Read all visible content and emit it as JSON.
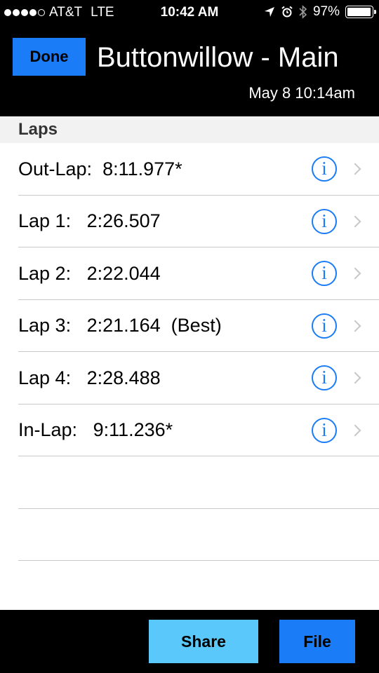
{
  "status_bar": {
    "carrier": "AT&T",
    "network": "LTE",
    "time": "10:42 AM",
    "battery_percent": "97%",
    "battery_level": 0.97,
    "signal_bars_filled": 4,
    "signal_bars_total": 5
  },
  "header": {
    "done_label": "Done",
    "title": "Buttonwillow - Main",
    "session_date": "May 8 10:14am"
  },
  "section": {
    "title": "Laps"
  },
  "laps": [
    {
      "label": "Out-Lap:  8:11.977*"
    },
    {
      "label": "Lap 1:   2:26.507"
    },
    {
      "label": "Lap 2:   2:22.044"
    },
    {
      "label": "Lap 3:   2:21.164  (Best)"
    },
    {
      "label": "Lap 4:   2:28.488"
    },
    {
      "label": "In-Lap:   9:11.236*"
    }
  ],
  "toolbar": {
    "share_label": "Share",
    "file_label": "File"
  },
  "colors": {
    "accent": "#1a7cf7",
    "share_button": "#5ac8fa",
    "bar_background": "#000000"
  }
}
